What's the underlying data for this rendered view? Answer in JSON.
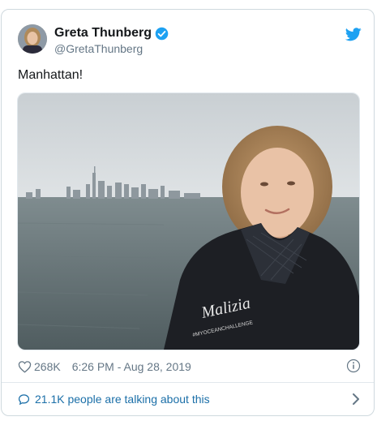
{
  "tweet": {
    "author_name": "Greta Thunberg",
    "handle": "@GretaThunberg",
    "text": "Manhattan!",
    "likes": "268K",
    "timestamp": "6:26 PM - Aug 28, 2019",
    "talking": "21.1K people are talking about this",
    "photo_caption_brand": "Malizia",
    "photo_caption_tag": "#MYOCEANCHALLENGE"
  },
  "icons": {
    "verified": "verified-badge-icon",
    "bird": "twitter-bird-icon",
    "heart": "heart-icon",
    "info": "info-icon",
    "bubble": "speech-bubble-icon",
    "chevron": "chevron-right-icon"
  },
  "colors": {
    "twitter_blue": "#1da1f2",
    "link_blue": "#1b6fa8",
    "text": "#14171a",
    "muted": "#657786"
  }
}
